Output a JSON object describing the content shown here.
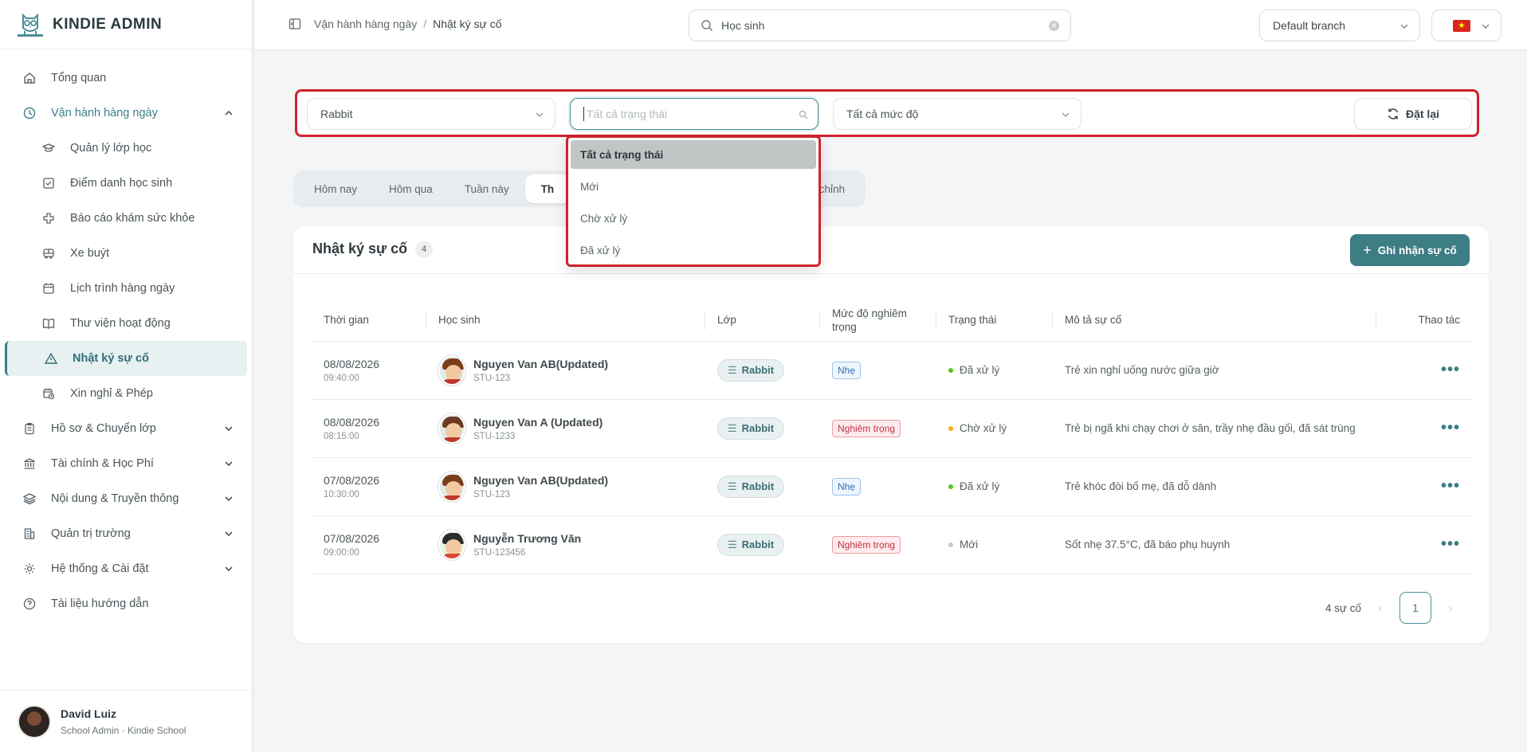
{
  "brand": {
    "name": "KINDIE ADMIN"
  },
  "sidebar": {
    "items": [
      {
        "label": "Tổng quan",
        "icon": "home-icon"
      },
      {
        "label": "Vận hành hàng ngày",
        "icon": "clock-icon",
        "expanded": true
      },
      {
        "label": "Hồ sơ & Chuyển lớp",
        "icon": "clipboard-icon"
      },
      {
        "label": "Tài chính & Học Phí",
        "icon": "bank-icon"
      },
      {
        "label": "Nội dung & Truyền thông",
        "icon": "layers-icon"
      },
      {
        "label": "Quản trị trường",
        "icon": "building-icon"
      },
      {
        "label": "Hệ thống & Cài đặt",
        "icon": "gear-icon"
      },
      {
        "label": "Tài liệu hướng dẫn",
        "icon": "help-icon"
      }
    ],
    "sub_items": [
      {
        "label": "Quản lý lớp học",
        "icon": "graduation-cap-icon"
      },
      {
        "label": "Điểm danh học sinh",
        "icon": "checkbox-icon"
      },
      {
        "label": "Báo cáo khám sức khỏe",
        "icon": "medical-cross-icon"
      },
      {
        "label": "Xe buýt",
        "icon": "bus-icon"
      },
      {
        "label": "Lịch trình hàng ngày",
        "icon": "calendar-icon"
      },
      {
        "label": "Thư viện hoạt động",
        "icon": "book-icon"
      },
      {
        "label": "Nhật ký sự cố",
        "icon": "warning-icon",
        "active": true
      },
      {
        "label": "Xin nghỉ & Phép",
        "icon": "calendar-clock-icon"
      }
    ],
    "user": {
      "name": "David Luiz",
      "role": "School Admin · Kindie School"
    }
  },
  "topbar": {
    "breadcrumb": [
      "Vận hành hàng ngày",
      "Nhật ký sự cố"
    ],
    "search_value": "Học sinh",
    "branch": "Default branch",
    "language_flag": "vn-flag"
  },
  "filters": {
    "class_value": "Rabbit",
    "status_placeholder": "Tất cả trạng thái",
    "severity_value": "Tất cả mức độ",
    "reset_label": "Đặt lại"
  },
  "status_dropdown": {
    "options": [
      "Tất cả trạng thái",
      "Mới",
      "Chờ xử lý",
      "Đã xử lý"
    ],
    "selected": "Tất cả trạng thái"
  },
  "date_tabs": {
    "items": [
      "Hôm nay",
      "Hôm qua",
      "Tuần này",
      "Th",
      "chỉnh"
    ],
    "active": "Th"
  },
  "card": {
    "title": "Nhật ký sự cố",
    "count": "4",
    "add_label": "Ghi nhận sự cố",
    "columns": [
      "Thời gian",
      "Học sinh",
      "Lớp",
      "Mức độ nghiêm trọng",
      "Trạng thái",
      "Mô tả sự cố",
      "Thao tác"
    ],
    "rows": [
      {
        "date": "08/08/2026",
        "time": "09:40:00",
        "name": "Nguyen Van AB(Updated)",
        "id": "STU-123",
        "class": "Rabbit",
        "severity": "Nhẹ",
        "severity_kind": "light",
        "status": "Đã xử lý",
        "status_color": "#52c41a",
        "desc": "Trẻ xin nghỉ uống nước giữa giờ"
      },
      {
        "date": "08/08/2026",
        "time": "08:15:00",
        "name": "Nguyen Van A (Updated)",
        "id": "STU-1233",
        "class": "Rabbit",
        "severity": "Nghiêm trọng",
        "severity_kind": "severe",
        "status": "Chờ xử lý",
        "status_color": "#faad14",
        "desc": "Trẻ bị ngã khi chạy chơi ở sân, trầy nhẹ đầu gối, đã sát trùng"
      },
      {
        "date": "07/08/2026",
        "time": "10:30:00",
        "name": "Nguyen Van AB(Updated)",
        "id": "STU-123",
        "class": "Rabbit",
        "severity": "Nhẹ",
        "severity_kind": "light",
        "status": "Đã xử lý",
        "status_color": "#52c41a",
        "desc": "Trẻ khóc đòi bố mẹ, đã dỗ dành"
      },
      {
        "date": "07/08/2026",
        "time": "09:00:00",
        "name": "Nguyễn Trương Văn",
        "id": "STU-123456",
        "class": "Rabbit",
        "severity": "Nghiêm trọng",
        "severity_kind": "severe",
        "status": "Mới",
        "status_color": "#c4c8ca",
        "desc": "Sốt nhẹ 37.5°C, đã báo phụ huynh"
      }
    ],
    "total_label": "4 sự cố",
    "page": "1"
  },
  "colors": {
    "primary": "#3d7d84",
    "highlight_red": "#d0212c"
  }
}
